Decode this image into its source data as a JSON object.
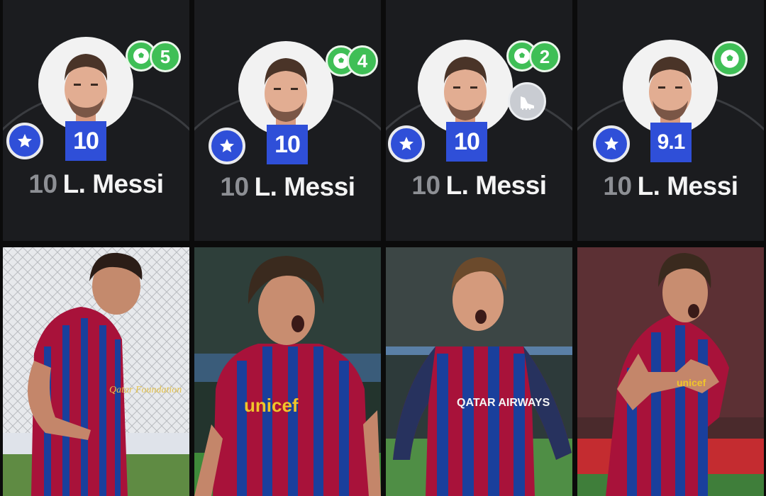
{
  "cards": [
    {
      "rating": "10",
      "goals": "5",
      "number": "10",
      "name": "L. Messi"
    },
    {
      "rating": "10",
      "goals": "4",
      "number": "10",
      "name": "L. Messi"
    },
    {
      "rating": "10",
      "goals": "2",
      "number": "10",
      "name": "L. Messi"
    },
    {
      "rating": "9.1",
      "goals": "",
      "number": "10",
      "name": "L. Messi"
    }
  ],
  "photos": [
    {
      "sponsor": "Qatar Foundation"
    },
    {
      "sponsor": "unicef"
    },
    {
      "sponsor": "QATAR AIRWAYS"
    },
    {
      "sponsor": "unicef"
    }
  ],
  "colors": {
    "card_bg": "#1b1c1f",
    "rating_blue": "#2f4fd8",
    "goal_green": "#3fbf56",
    "barca_red": "#a8123a",
    "barca_blue": "#1a3f9c"
  },
  "icons": [
    "star-icon",
    "football-icon",
    "boot-icon"
  ]
}
